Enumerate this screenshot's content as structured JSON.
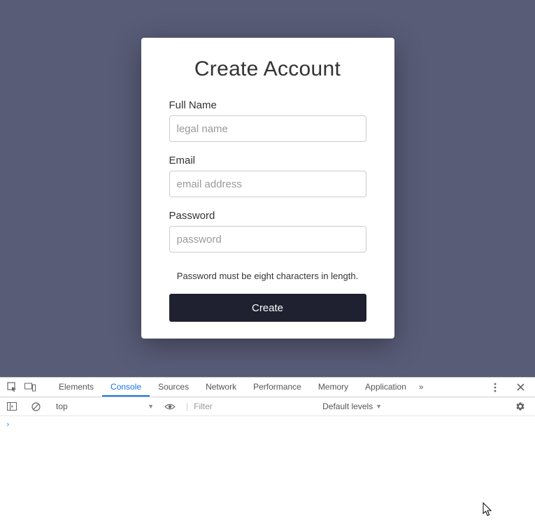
{
  "form": {
    "title": "Create Account",
    "fullname_label": "Full Name",
    "fullname_placeholder": "legal name",
    "email_label": "Email",
    "email_placeholder": "email address",
    "password_label": "Password",
    "password_placeholder": "password",
    "password_hint": "Password must be eight characters in length.",
    "submit_label": "Create"
  },
  "devtools": {
    "tabs": {
      "elements": "Elements",
      "console": "Console",
      "sources": "Sources",
      "network": "Network",
      "performance": "Performance",
      "memory": "Memory",
      "application": "Application"
    },
    "more_tabs_glyph": "»",
    "context": "top",
    "filter_placeholder": "Filter",
    "levels_label": "Default levels",
    "prompt_glyph": "›"
  }
}
